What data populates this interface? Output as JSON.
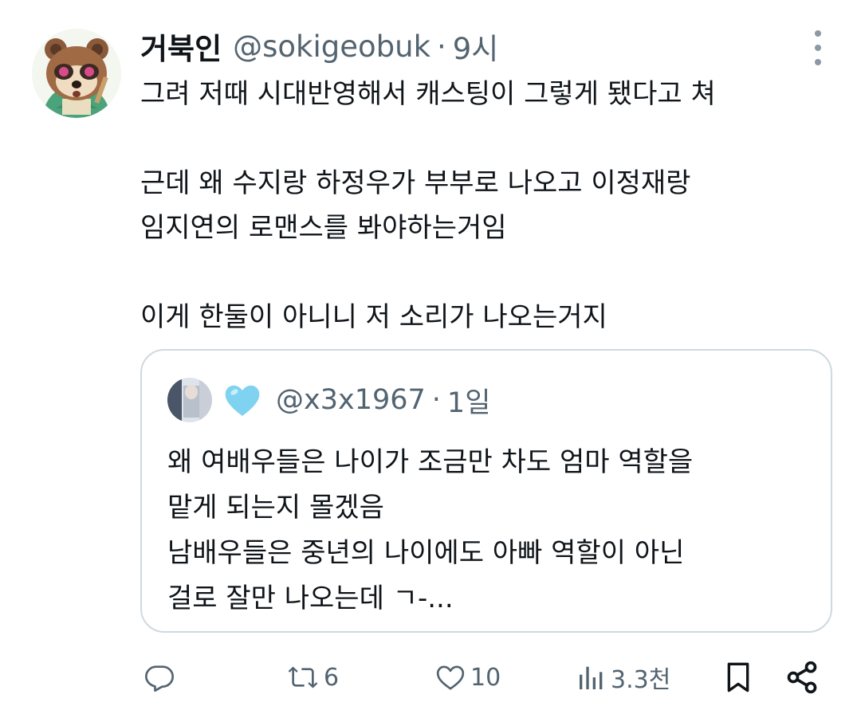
{
  "tweet": {
    "display_name": "거북인",
    "handle": "@sokigeobuk",
    "separator": "·",
    "time": "9시",
    "text_lines": [
      "그려 저때 시대반영해서 캐스팅이 그렇게 됐다고 쳐",
      "",
      "근데 왜 수지랑 하정우가 부부로 나오고 이정재랑",
      "임지연의 로맨스를 봐야하는거임",
      "",
      "이게 한둘이 아니니 저 소리가 나오는거지"
    ]
  },
  "quote": {
    "handle": "@x3x1967",
    "separator": "·",
    "time": "1일",
    "heart_icon": "light-blue-heart-emoji",
    "text_lines": [
      "왜 여배우들은 나이가 조금만 차도 엄마 역할을",
      "맡게 되는지 몰겠음",
      "남배우들은 중년의 나이에도 아빠 역할이 아닌",
      "걸로 잘만 나오는데 ㄱ-..."
    ]
  },
  "actions": {
    "reply_icon": "reply-icon",
    "retweet_icon": "retweet-icon",
    "retweet_count": "6",
    "like_icon": "like-icon",
    "like_count": "10",
    "views_icon": "views-icon",
    "views_count": "3.3천",
    "bookmark_icon": "bookmark-icon",
    "share_icon": "share-icon"
  },
  "colors": {
    "text": "#0f1419",
    "secondary": "#536471",
    "border": "#cfd9de",
    "heart": "#7fd3f0"
  }
}
